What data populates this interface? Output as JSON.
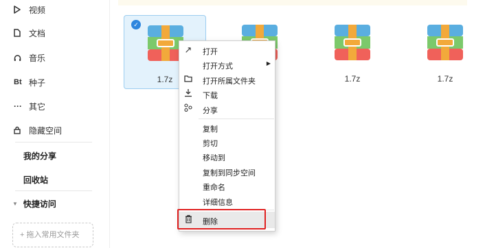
{
  "sidebar": {
    "items": [
      {
        "icon": "video-icon",
        "label": "视频"
      },
      {
        "icon": "document-icon",
        "label": "文档"
      },
      {
        "icon": "headphones-icon",
        "label": "音乐"
      },
      {
        "icon": "bt-icon",
        "label": "种子"
      },
      {
        "icon": "more-icon",
        "label": "其它"
      },
      {
        "icon": "lock-icon",
        "label": "隐藏空间"
      }
    ],
    "my_share": "我的分享",
    "recycle_bin": "回收站",
    "quick_access": "快捷访问",
    "drop_hint": "+ 拖入常用文件夹"
  },
  "files": [
    {
      "name": "1.7z",
      "selected": true
    },
    {
      "name": "",
      "selected": false
    },
    {
      "name": "1.7z",
      "selected": false
    },
    {
      "name": "1.7z",
      "selected": false
    }
  ],
  "context_menu": {
    "items": [
      {
        "icon": "open-arrow-icon",
        "label": "打开"
      },
      {
        "icon": "",
        "label": "打开方式",
        "submenu_arrow": "▶"
      },
      {
        "icon": "folder-icon",
        "label": "打开所属文件夹"
      },
      {
        "icon": "download-icon",
        "label": "下载"
      },
      {
        "icon": "share-icon",
        "label": "分享"
      },
      {
        "label": "复制"
      },
      {
        "label": "剪切"
      },
      {
        "label": "移动到"
      },
      {
        "label": "复制到同步空间"
      },
      {
        "label": "重命名"
      },
      {
        "label": "详细信息"
      },
      {
        "icon": "trash-icon",
        "label": "删除"
      }
    ]
  },
  "colors": {
    "accent": "#2e86de",
    "highlight_border": "#e02020",
    "zip_blue": "#5aaee0",
    "zip_green": "#7cc96b",
    "zip_red": "#f0615a",
    "zip_band": "#f2a93b"
  }
}
